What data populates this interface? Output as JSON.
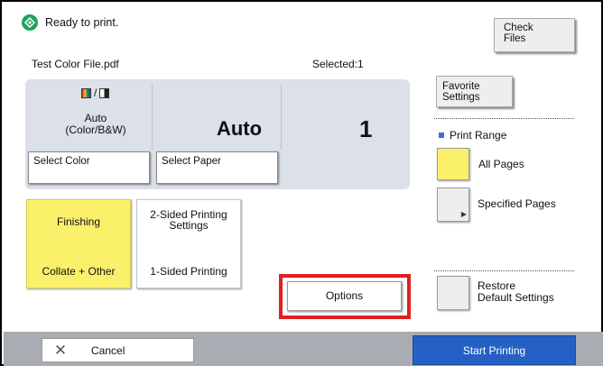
{
  "status": {
    "text": "Ready to print.",
    "icon": "ready-icon",
    "color": "#1ea35a"
  },
  "header": {
    "check_files_label": "Check\nFiles",
    "filename": "Test Color File.pdf",
    "selected": "Selected:1"
  },
  "settings": {
    "color_mode": "Auto\n(Color/B&W)",
    "color_mode_icon": "color-bw-icon",
    "paper": "Auto",
    "copies": "1",
    "select_color_label": "Select Color",
    "select_paper_label": "Select Paper"
  },
  "finishing": {
    "title": "Finishing",
    "value": "Collate + Other",
    "color": "#fbf06a"
  },
  "two_sided": {
    "title": "2-Sided Printing\nSettings",
    "value": "1-Sided Printing"
  },
  "options_label": "Options",
  "right": {
    "favorite_label": "Favorite\nSettings",
    "print_range_title": "Print Range",
    "all_pages_label": "All Pages",
    "specified_pages_label": "Specified Pages",
    "restore_label": "Restore\nDefault Settings"
  },
  "footer": {
    "cancel_label": "Cancel",
    "start_label": "Start Printing",
    "accent": "#2560c4"
  }
}
